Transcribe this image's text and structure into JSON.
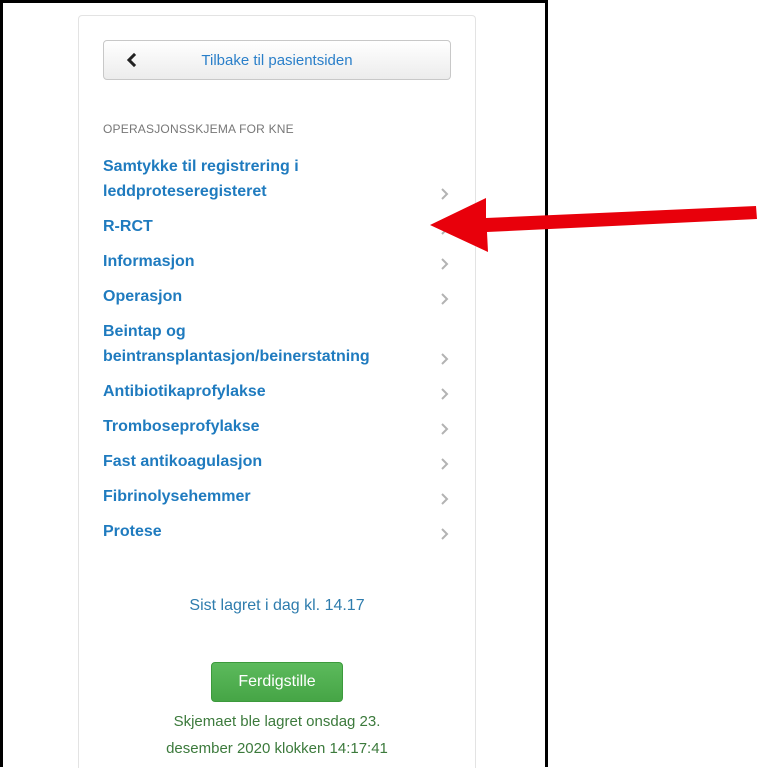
{
  "back_button": {
    "label": "Tilbake til pasientsiden",
    "icon": "chevron-left-icon"
  },
  "section": {
    "heading": "OPERASJONSSKJEMA FOR KNE"
  },
  "nav_items": [
    {
      "label": "Samtykke til registrering i leddproteseregisteret"
    },
    {
      "label": "R-RCT"
    },
    {
      "label": "Informasjon"
    },
    {
      "label": "Operasjon"
    },
    {
      "label": "Beintap og beintransplantasjon/beinerstatning"
    },
    {
      "label": "Antibiotikaprofylakse"
    },
    {
      "label": "Tromboseprofylakse"
    },
    {
      "label": "Fast antikoagulasjon"
    },
    {
      "label": "Fibrinolysehemmer"
    },
    {
      "label": "Protese"
    }
  ],
  "status": {
    "saved_text": "Sist lagret i dag kl. 14.17"
  },
  "finish_button": {
    "label": "Ferdigstille"
  },
  "save_message": {
    "line1": "Skjemaet ble lagret onsdag 23.",
    "line2": "desember 2020 klokken 14:17:41"
  },
  "colors": {
    "link": "#1f7bbf",
    "finish": "#5cba5c",
    "arrow": "#e8000b"
  }
}
